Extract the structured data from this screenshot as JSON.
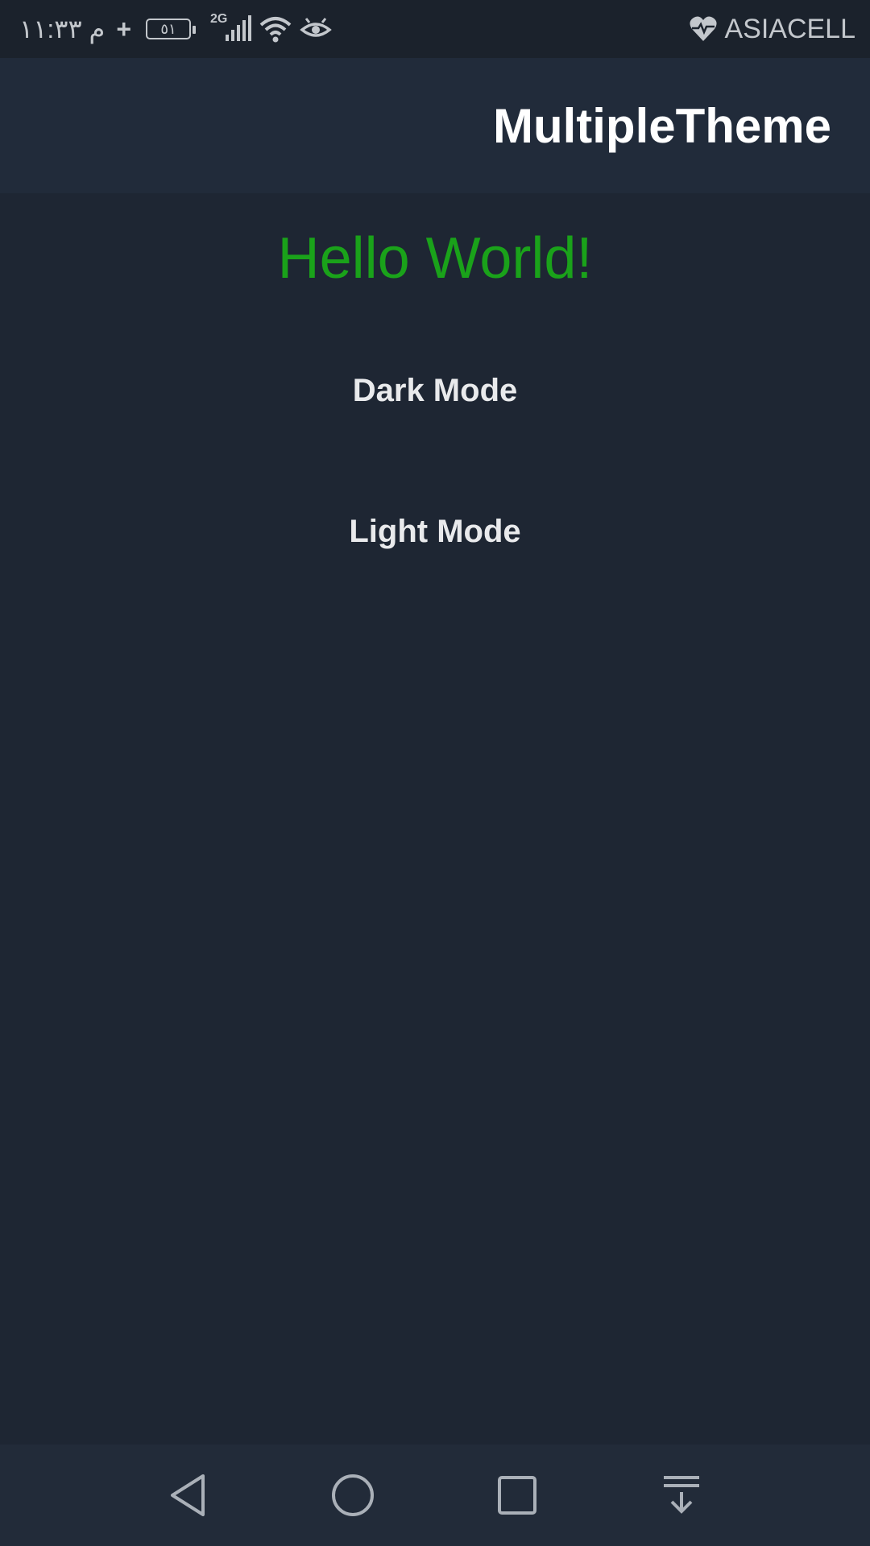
{
  "status_bar": {
    "time": "م ١١:٣٣",
    "charging_symbol": "+",
    "battery_level": "٥١",
    "network_type": "2G",
    "carrier": "ASIACELL",
    "icons": [
      "signal-icon",
      "wifi-icon",
      "eye-icon",
      "heart-pulse-icon"
    ]
  },
  "app_bar": {
    "title": "MultipleTheme"
  },
  "main": {
    "hello_text": "Hello World!",
    "dark_mode_label": "Dark Mode",
    "light_mode_label": "Light Mode"
  },
  "nav_bar": {
    "icons": [
      "back-icon",
      "home-icon",
      "recents-icon",
      "notification-pull-icon"
    ]
  },
  "colors": {
    "background": "#1e2633",
    "app_bar": "#212b3a",
    "status_bar": "#1b222c",
    "accent_green": "#1aa21a",
    "text_light": "#e9eaec"
  }
}
